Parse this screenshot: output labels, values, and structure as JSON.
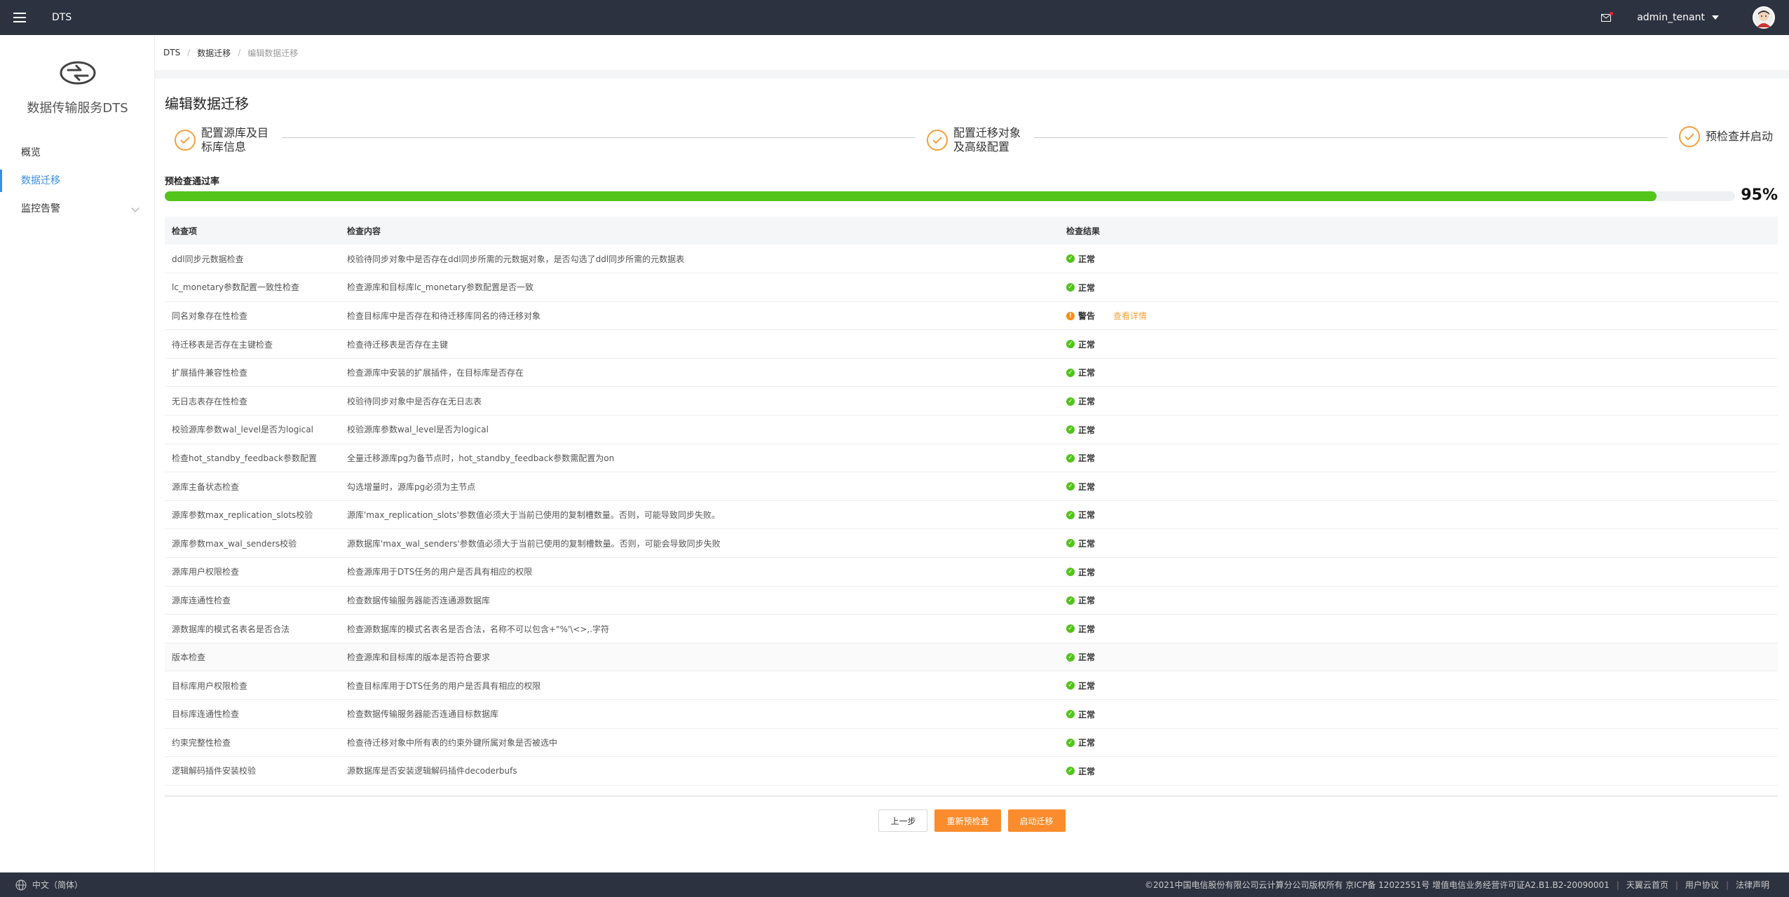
{
  "topbar": {
    "app_name": "DTS",
    "username": "admin_tenant"
  },
  "sidebar": {
    "logo_title": "数据传输服务DTS",
    "items": [
      {
        "label": "概览"
      },
      {
        "label": "数据迁移"
      },
      {
        "label": "监控告警"
      }
    ]
  },
  "breadcrumb": {
    "root": "DTS",
    "parent": "数据迁移",
    "current": "编辑数据迁移"
  },
  "page": {
    "title": "编辑数据迁移",
    "steps": [
      {
        "line1": "配置源库及目",
        "line2": "标库信息"
      },
      {
        "line1": "配置迁移对象",
        "line2": "及高级配置"
      },
      {
        "line1": "预检查并启动",
        "line2": ""
      }
    ],
    "pass_label": "预检查通过率",
    "pass_rate": 95,
    "pass_rate_text": "95%"
  },
  "table": {
    "headers": [
      "检查项",
      "检查内容",
      "检查结果"
    ],
    "status_ok": "正常",
    "status_warn": "警告",
    "detail_link": "查看详情",
    "rows": [
      {
        "item": "ddl同步元数据检查",
        "content": "校验待同步对象中是否存在ddl同步所需的元数据对象，是否勾选了ddl同步所需的元数据表"
      },
      {
        "item": "lc_monetary参数配置一致性检查",
        "content": "检查源库和目标库lc_monetary参数配置是否一致"
      },
      {
        "item": "同名对象存在性检查",
        "content": "检查目标库中是否存在和待迁移库同名的待迁移对象"
      },
      {
        "item": "待迁移表是否存在主键检查",
        "content": "检查待迁移表是否存在主键"
      },
      {
        "item": "扩展插件兼容性检查",
        "content": "检查源库中安装的扩展插件，在目标库是否存在"
      },
      {
        "item": "无日志表存在性检查",
        "content": "校验待同步对象中是否存在无日志表"
      },
      {
        "item": "校验源库参数wal_level是否为logical",
        "content": "校验源库参数wal_level是否为logical"
      },
      {
        "item": "检查hot_standby_feedback参数配置",
        "content": "全量迁移源库pg为备节点时，hot_standby_feedback参数需配置为on"
      },
      {
        "item": "源库主备状态检查",
        "content": "勾选增量时，源库pg必须为主节点"
      },
      {
        "item": "源库参数max_replication_slots校验",
        "content": "源库'max_replication_slots'参数值必须大于当前已使用的复制槽数量。否则，可能导致同步失败。"
      },
      {
        "item": "源库参数max_wal_senders校验",
        "content": "源数据库'max_wal_senders'参数值必须大于当前已使用的复制槽数量。否则，可能会导致同步失败"
      },
      {
        "item": "源库用户权限检查",
        "content": "检查源库用于DTS任务的用户是否具有相应的权限"
      },
      {
        "item": "源库连通性检查",
        "content": "检查数据传输服务器能否连通源数据库"
      },
      {
        "item": "源数据库的模式名表名是否合法",
        "content": "检查源数据库的模式名表名是否合法，名称不可以包含+\"%'\\<>,.字符"
      },
      {
        "item": "版本检查",
        "content": "检查源库和目标库的版本是否符合要求"
      },
      {
        "item": "目标库用户权限检查",
        "content": "检查目标库用于DTS任务的用户是否具有相应的权限"
      },
      {
        "item": "目标库连通性检查",
        "content": "检查数据传输服务器能否连通目标数据库"
      },
      {
        "item": "约束完整性检查",
        "content": "检查待迁移对象中所有表的约束外键所属对象是否被选中"
      },
      {
        "item": "逻辑解码插件安装校验",
        "content": "源数据库是否安装逻辑解码插件decoderbufs"
      }
    ]
  },
  "buttons": {
    "prev": "上一步",
    "recheck": "重新预检查",
    "start": "启动迁移"
  },
  "footer": {
    "language": "中文（简体）",
    "copyright": "©2021中国电信股份有限公司云计算分公司版权所有 京ICP备 12022551号 增值电信业务经营许可证A2.B1.B2-20090001",
    "links": [
      "天翼云首页",
      "用户协议",
      "法律声明"
    ]
  },
  "colors": {
    "accent": "#3a8ee6",
    "primary_button": "#fa8c2d",
    "progress": "#52c41a",
    "topbar": "#2d3240"
  }
}
